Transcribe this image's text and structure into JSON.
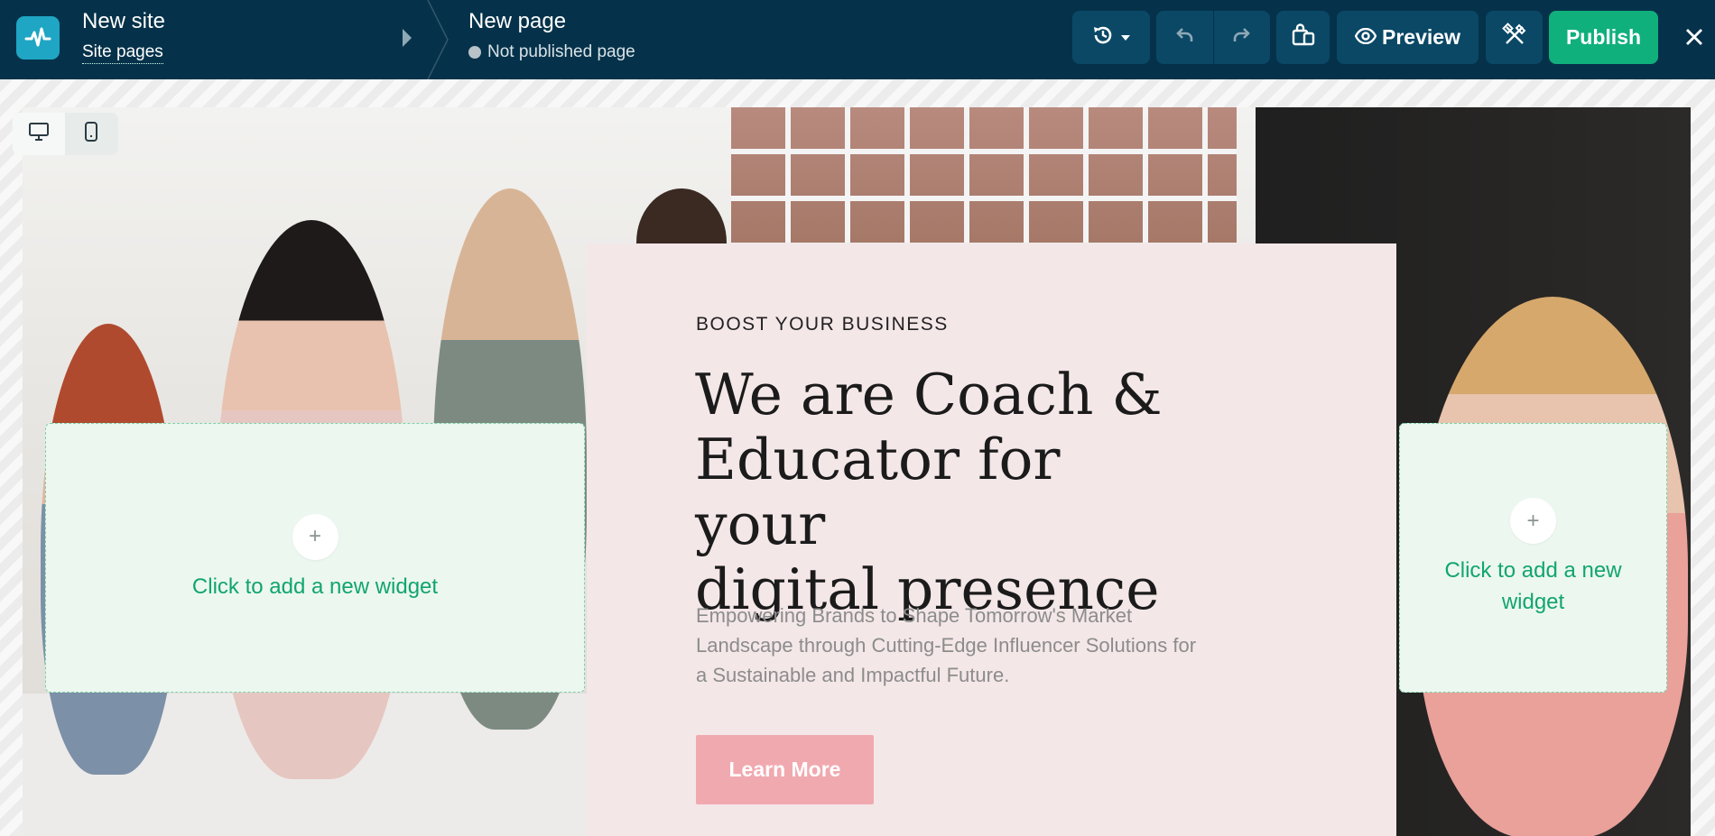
{
  "topbar": {
    "site_title": "New site",
    "site_pages_link": "Site pages",
    "page_title": "New page",
    "page_status": "Not published page",
    "preview_label": "Preview",
    "publish_label": "Publish",
    "icons": {
      "logo": "pulse-logo-icon",
      "history": "history-icon",
      "undo": "undo-icon",
      "redo": "redo-icon",
      "store": "store-icon",
      "preview": "eye-icon",
      "design": "design-tools-icon",
      "close": "close-icon"
    }
  },
  "device_toggle": {
    "options": [
      "desktop",
      "mobile"
    ],
    "selected": "desktop"
  },
  "hero": {
    "eyebrow": "BOOST YOUR BUSINESS",
    "headline_lines": [
      "We are Coach &",
      "Educator for your",
      "digital presence"
    ],
    "body_lines": [
      "Empowering Brands to Shape Tomorrow's Market",
      "Landscape through Cutting-Edge Influencer Solutions for",
      "a Sustainable and Impactful Future."
    ],
    "cta_label": "Learn More"
  },
  "widget_slots": {
    "left_label": "Click to add a new widget",
    "right_label": "Click to add a new widget"
  },
  "colors": {
    "topbar_bg": "#05324a",
    "button_bg": "#0a4866",
    "publish_green": "#10b07c",
    "logo_blue": "#1fa6c4",
    "hero_card_bg": "#f4e7e8",
    "cta_pink": "#f1a9b0",
    "slot_bg": "#ecf7ef",
    "slot_text": "#11a56e"
  }
}
